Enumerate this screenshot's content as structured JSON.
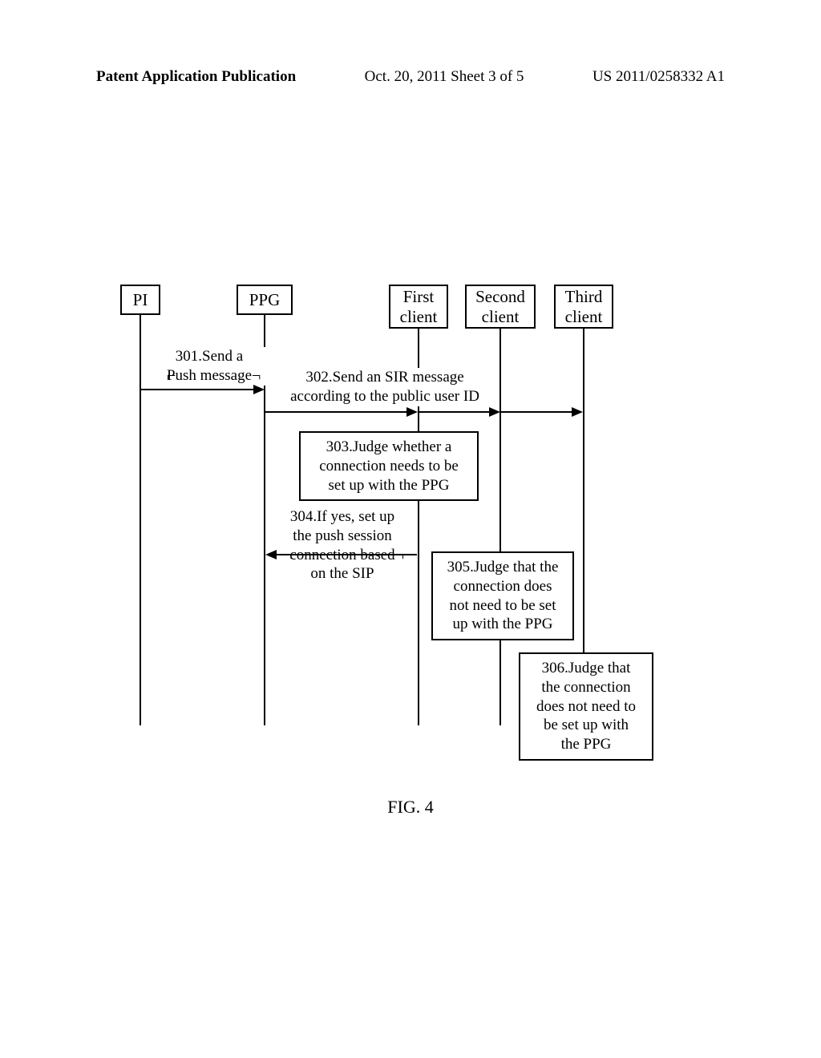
{
  "header": {
    "left": "Patent Application Publication",
    "center": "Oct. 20, 2011  Sheet 3 of 5",
    "right": "US 2011/0258332 A1"
  },
  "actors": {
    "pi": "PI",
    "ppg": "PPG",
    "client1_line1": "First",
    "client1_line2": "client",
    "client2_line1": "Second",
    "client2_line2": "client",
    "client3_line1": "Third",
    "client3_line2": "client"
  },
  "messages": {
    "msg301_line1": "301.Send a",
    "msg301_line2": "Push message",
    "msg302_line1": "302.Send an SIR message",
    "msg302_line2": "according to the public user ID",
    "msg304_line1": "304.If yes, set up",
    "msg304_line2": "the push session",
    "msg304_line3": "connection based",
    "msg304_line4": "on the SIP"
  },
  "notes": {
    "note303_line1": "303.Judge whether a",
    "note303_line2": "connection needs to be",
    "note303_line3": "set up with the PPG",
    "note305_line1": "305.Judge that the",
    "note305_line2": "connection does",
    "note305_line3": "not need to be set",
    "note305_line4": "up with the PPG",
    "note306_line1": "306.Judge that",
    "note306_line2": "the connection",
    "note306_line3": "does not need to",
    "note306_line4": "be set up with",
    "note306_line5": "the PPG"
  },
  "caption": "FIG. 4",
  "chart_data": {
    "type": "sequence_diagram",
    "actors": [
      "PI",
      "PPG",
      "First client",
      "Second client",
      "Third client"
    ],
    "events": [
      {
        "step": 301,
        "from": "PI",
        "to": "PPG",
        "label": "Send a Push message"
      },
      {
        "step": 302,
        "from": "PPG",
        "to": [
          "First client",
          "Second client",
          "Third client"
        ],
        "label": "Send an SIR message according to the public user ID"
      },
      {
        "step": 303,
        "actor": "First client",
        "type": "note",
        "label": "Judge whether a connection needs to be set up with the PPG"
      },
      {
        "step": 304,
        "from": "First client",
        "to": "PPG",
        "label": "If yes, set up the push session connection based on the SIP"
      },
      {
        "step": 305,
        "actor": "Second client",
        "type": "note",
        "label": "Judge that the connection does not need to be set up with the PPG"
      },
      {
        "step": 306,
        "actor": "Third client",
        "type": "note",
        "label": "Judge that the connection does not need to be set up with the PPG"
      }
    ]
  }
}
